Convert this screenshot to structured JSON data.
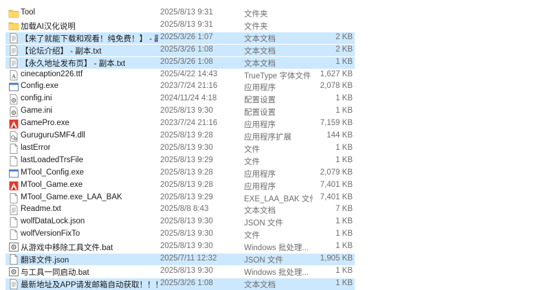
{
  "files": [
    {
      "name": "Tool",
      "date": "2025/8/13 9:31",
      "type": "文件夹",
      "size": "",
      "icon": "folder-icon",
      "selected": false
    },
    {
      "name": "加载AI汉化说明",
      "date": "2025/8/13 9:31",
      "type": "文件夹",
      "size": "",
      "icon": "folder-icon",
      "selected": false
    },
    {
      "name": "【来了就能下载和观看！纯免费！】 - 副...",
      "date": "2025/3/26 1:07",
      "type": "文本文档",
      "size": "2 KB",
      "icon": "text-file-icon",
      "selected": true
    },
    {
      "name": "【论坛介绍】 - 副本.txt",
      "date": "2025/3/26 1:08",
      "type": "文本文档",
      "size": "2 KB",
      "icon": "text-file-icon",
      "selected": true
    },
    {
      "name": "【永久地址发布页】 - 副本.txt",
      "date": "2025/3/26 1:08",
      "type": "文本文档",
      "size": "1 KB",
      "icon": "text-file-icon",
      "selected": true
    },
    {
      "name": "cinecaption226.ttf",
      "date": "2025/4/22 14:43",
      "type": "TrueType 字体文件",
      "size": "1,627 KB",
      "icon": "font-file-icon",
      "selected": false
    },
    {
      "name": "Config.exe",
      "date": "2023/7/24 21:16",
      "type": "应用程序",
      "size": "2,078 KB",
      "icon": "app-window-icon",
      "selected": false
    },
    {
      "name": "config.ini",
      "date": "2024/11/24 4:18",
      "type": "配置设置",
      "size": "1 KB",
      "icon": "settings-file-icon",
      "selected": false
    },
    {
      "name": "Game.ini",
      "date": "2025/8/13 9:30",
      "type": "配置设置",
      "size": "1 KB",
      "icon": "settings-file-icon",
      "selected": false
    },
    {
      "name": "GamePro.exe",
      "date": "2023/7/24 21:16",
      "type": "应用程序",
      "size": "7,159 KB",
      "icon": "game-app-icon",
      "selected": false
    },
    {
      "name": "GuruguruSMF4.dll",
      "date": "2025/8/13 9:28",
      "type": "应用程序扩展",
      "size": "144 KB",
      "icon": "dll-file-icon",
      "selected": false
    },
    {
      "name": "lastError",
      "date": "2025/8/13 9:30",
      "type": "文件",
      "size": "1 KB",
      "icon": "blank-file-icon",
      "selected": false
    },
    {
      "name": "lastLoadedTrsFile",
      "date": "2025/8/13 9:29",
      "type": "文件",
      "size": "1 KB",
      "icon": "blank-file-icon",
      "selected": false
    },
    {
      "name": "MTool_Config.exe",
      "date": "2025/8/13 9:28",
      "type": "应用程序",
      "size": "2,079 KB",
      "icon": "app-window-icon",
      "selected": false
    },
    {
      "name": "MTool_Game.exe",
      "date": "2025/8/13 9:28",
      "type": "应用程序",
      "size": "7,401 KB",
      "icon": "game-app-icon",
      "selected": false
    },
    {
      "name": "MTool_Game.exe_LAA_BAK",
      "date": "2025/8/13 9:29",
      "type": "EXE_LAA_BAK 文件",
      "size": "7,401 KB",
      "icon": "blank-file-icon",
      "selected": false
    },
    {
      "name": "Readme.txt",
      "date": "2025/8/8 8:43",
      "type": "文本文档",
      "size": "7 KB",
      "icon": "text-file-icon",
      "selected": false
    },
    {
      "name": "wolfDataLock.json",
      "date": "2025/8/13 9:30",
      "type": "JSON 文件",
      "size": "1 KB",
      "icon": "blank-file-icon",
      "selected": false
    },
    {
      "name": "wolfVersionFixTo",
      "date": "2025/8/13 9:30",
      "type": "文件",
      "size": "1 KB",
      "icon": "blank-file-icon",
      "selected": false
    },
    {
      "name": "从游戏中移除工具文件.bat",
      "date": "2025/8/13 9:30",
      "type": "Windows 批处理...",
      "size": "1 KB",
      "icon": "batch-file-icon",
      "selected": false
    },
    {
      "name": "翻译文件.json",
      "date": "2025/7/11 12:32",
      "type": "JSON 文件",
      "size": "1,905 KB",
      "icon": "blank-file-icon",
      "selected": true
    },
    {
      "name": "与工具一同启动.bat",
      "date": "2025/8/13 9:30",
      "type": "Windows 批处理...",
      "size": "1 KB",
      "icon": "batch-file-icon",
      "selected": false
    },
    {
      "name": "最新地址及APP请发邮箱自动获取！！！...",
      "date": "2025/3/26 1:08",
      "type": "文本文档",
      "size": "1 KB",
      "icon": "text-file-icon",
      "selected": true
    }
  ]
}
